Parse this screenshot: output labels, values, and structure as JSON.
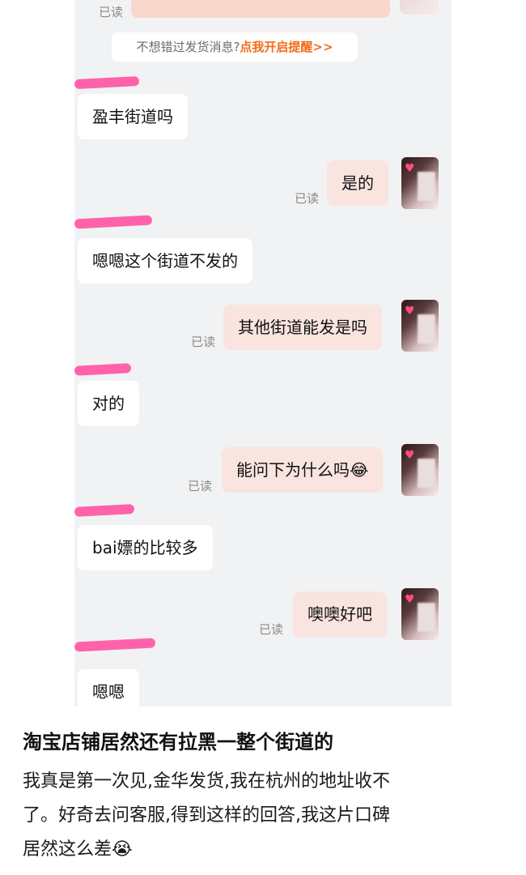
{
  "chat": {
    "top_read_label": "已读",
    "notice": {
      "prefix": "不想错过发货消息?",
      "link": "点我开启提醒>>"
    },
    "messages": [
      {
        "side": "in",
        "text": "盈丰街道吗"
      },
      {
        "side": "out",
        "text": "是的",
        "read": "已读"
      },
      {
        "side": "in",
        "text": "嗯嗯这个街道不发的"
      },
      {
        "side": "out",
        "text": "其他街道能发是吗",
        "read": "已读"
      },
      {
        "side": "in",
        "text": "对的"
      },
      {
        "side": "out",
        "text": "能问下为什么吗😂",
        "read": "已读"
      },
      {
        "side": "in",
        "text": "bai嫖的比较多"
      },
      {
        "side": "out",
        "text": "噢噢好吧",
        "read": "已读"
      },
      {
        "side": "in",
        "text": "嗯嗯"
      }
    ],
    "avatar_badge": "♥",
    "colors": {
      "incoming_bubble": "#ffffff",
      "outgoing_bubble": "#f9e4df",
      "redaction": "#ff5aa4",
      "link": "#f06d18",
      "background": "#f1f2f4"
    }
  },
  "post": {
    "title": "淘宝店铺居然还有拉黑一整个街道的",
    "body_lines": [
      "我真是第一次见,金华发货,我在杭州的地址收不",
      "了。好奇去问客服,得到这样的回答,我这片口碑",
      "居然这么差😭"
    ]
  }
}
